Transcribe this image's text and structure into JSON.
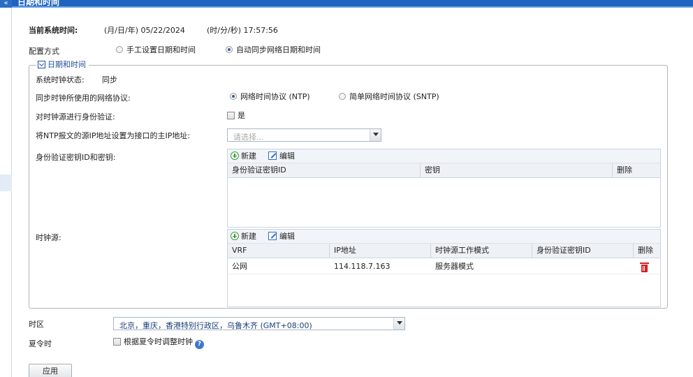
{
  "title": "日期和时间",
  "current_time": {
    "label": "当前系统时间:",
    "date_fmt": "(月/日/年)",
    "date": "05/22/2024",
    "time_fmt": "(时/分/秒)",
    "time": "17:57:56"
  },
  "config_mode": {
    "label": "配置方式",
    "manual": "手工设置日期和时间",
    "auto": "自动同步网络日期和时间",
    "selected": "auto"
  },
  "section": {
    "legend": "日期和时间",
    "clock_status_label": "系统时钟状态:",
    "clock_status_value": "同步",
    "protocol_label": "同步时钟所使用的网络协议:",
    "protocol_ntp": "网络时间协议 (NTP)",
    "protocol_sntp": "简单网络时间协议 (SNTP)",
    "protocol_selected": "ntp",
    "auth_label": "对时钟源进行身份验证:",
    "auth_checkbox": "是",
    "src_ip_label": "将NTP报文的源IP地址设置为接口的主IP地址:",
    "src_ip_placeholder": "请选择...",
    "keys_label": "身份验证密钥ID和密钥:",
    "clock_source_label": "时钟源:"
  },
  "keys_grid": {
    "new_label": "新建",
    "edit_label": "编辑",
    "columns": [
      "身份验证密钥ID",
      "密钥",
      "删除"
    ],
    "rows": []
  },
  "sources_grid": {
    "new_label": "新建",
    "edit_label": "编辑",
    "columns": [
      "VRF",
      "IP地址",
      "时钟源工作模式",
      "身份验证密钥ID",
      "删除"
    ],
    "rows": [
      {
        "vrf": "公网",
        "ip": "114.118.7.163",
        "mode": "服务器模式",
        "key_id": ""
      }
    ]
  },
  "timezone": {
    "label": "时区",
    "value": "北京，重庆，香港特别行政区，乌鲁木齐 (GMT+08:00)"
  },
  "dst": {
    "label": "夏令时",
    "checkbox": "根据夏令时调整时钟"
  },
  "apply_label": "应用",
  "colors": {
    "title_bar": "#1f64bf",
    "legend_text": "#1a4fa0",
    "delete_icon": "#d41f1f"
  },
  "icons": [
    "collapse-icon",
    "add-icon",
    "edit-icon",
    "delete-icon",
    "help-icon",
    "dropdown-arrow-icon",
    "expand-toggle-icon"
  ]
}
